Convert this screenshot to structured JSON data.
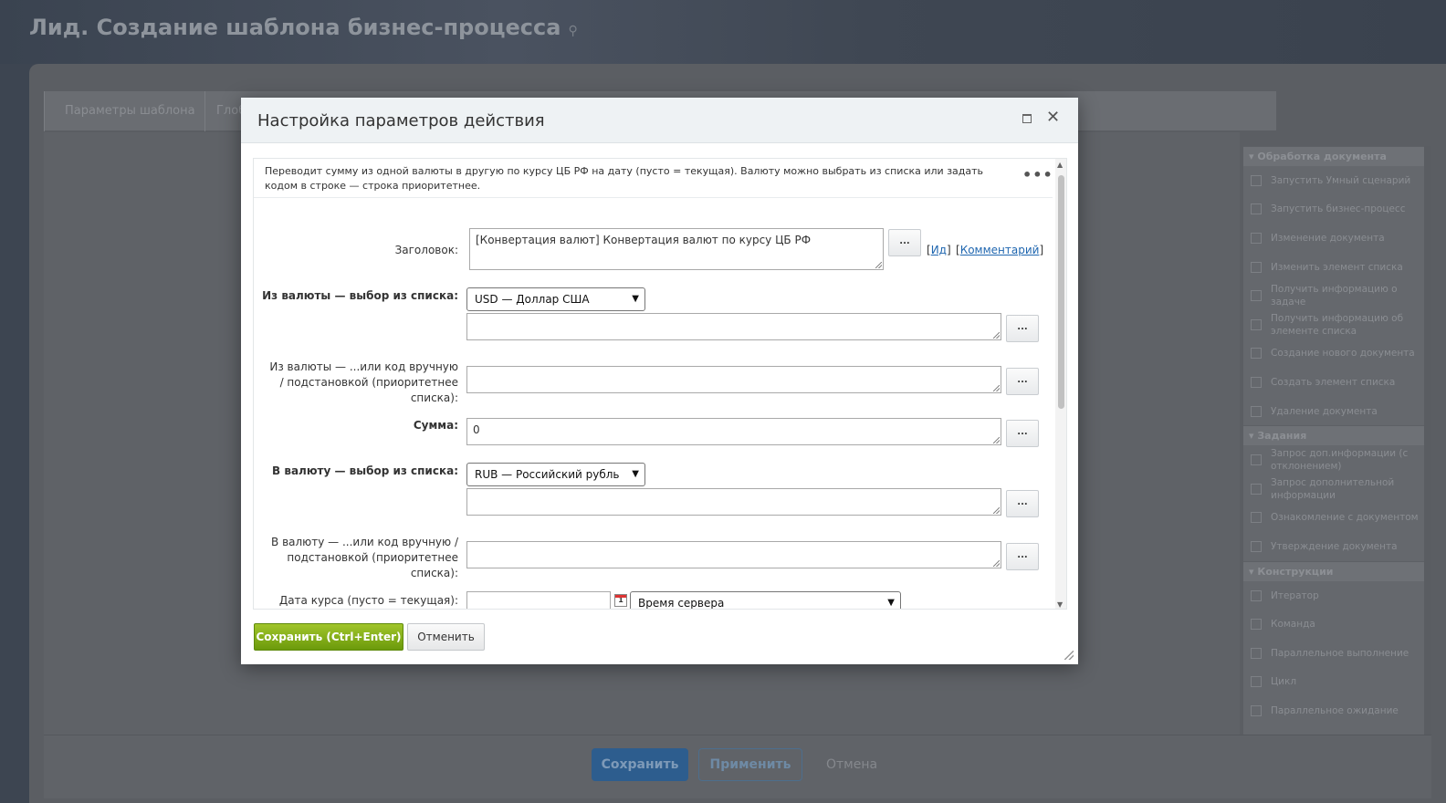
{
  "page": {
    "title": "Лид. Создание шаблона бизнес-процесса",
    "tabs": [
      "Параметры шаблона",
      "Глоб"
    ],
    "footer": {
      "save": "Сохранить",
      "apply": "Применить",
      "cancel": "Отмена"
    }
  },
  "toolbox": {
    "groups": [
      {
        "title": "Обработка документа",
        "items": [
          "Запустить Умный сценарий",
          "Запустить бизнес-процесс",
          "Изменение документа",
          "Изменить элемент списка",
          "Получить информацию о задаче",
          "Получить информацию об элементе списка",
          "Создание нового документа",
          "Создать элемент списка",
          "Удаление документа"
        ]
      },
      {
        "title": "Задания",
        "items": [
          "Запрос доп.информации (с отклонением)",
          "Запрос дополнительной информации",
          "Ознакомление с документом",
          "Утверждение документа"
        ]
      },
      {
        "title": "Конструкции",
        "items": [
          "Итератор",
          "Команда",
          "Параллельное выполнение",
          "Цикл",
          "Параллельное ожидание"
        ]
      }
    ]
  },
  "dialog": {
    "title": "Настройка параметров действия",
    "description": "Переводит сумму из одной валюты в другую по курсу ЦБ РФ на дату (пусто = текущая). Валюту можно выбрать из списка или задать кодом в строке — строка приоритетнее.",
    "more": "•••",
    "fields": {
      "title_label": "Заголовок:",
      "title_value": "[Конвертация валют] Конвертация валют по курсу ЦБ РФ",
      "id_link": "Ид",
      "comment_link": "Комментарий",
      "from_list_label": "Из валюты — выбор из списка:",
      "from_list_value": "USD — Доллар США",
      "from_code_label": "Из валюты — ...или код вручную / подстановкой (приоритетнее списка):",
      "amount_label": "Сумма:",
      "amount_value": "0",
      "to_list_label": "В валюту — выбор из списка:",
      "to_list_value": "RUB — Российский рубль",
      "to_code_label": "В валюту — ...или код вручную / подстановкой (приоритетнее списка):",
      "date_label": "Дата курса (пусто = текущая):",
      "date_value": "",
      "timezone_value": "Время сервера",
      "dots": "...",
      "calendar": "1"
    },
    "buttons": {
      "save": "Сохранить (Ctrl+Enter)",
      "cancel": "Отменить"
    }
  }
}
